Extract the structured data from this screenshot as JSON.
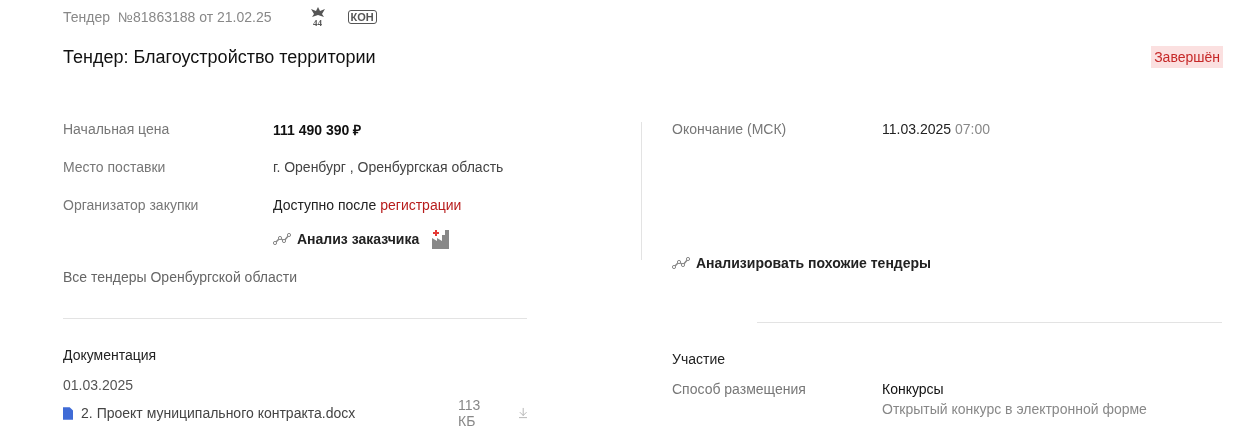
{
  "header": {
    "label": "Тендер",
    "number": "№81863188 от 21.02.25",
    "law_badge": "44",
    "type_badge": "КОН"
  },
  "title": "Тендер: Благоустройство территории",
  "status": "Завершён",
  "left_fields": [
    {
      "label": "Начальная цена",
      "value": "111 490 390 ₽",
      "kind": "price"
    },
    {
      "label": "Место поставки",
      "value": "г. Оренбург , Оренбургская область",
      "kind": "text"
    },
    {
      "label": "Организатор закупки",
      "value": "Доступно после",
      "link": "регистрации",
      "kind": "locked"
    }
  ],
  "customer_analysis": "Анализ заказчика",
  "region_link": "Все тендеры Оренбургской области",
  "right_fields": [
    {
      "label": "Окончание (МСК)",
      "value": "11.03.2025",
      "time": "07:00"
    }
  ],
  "similar_link": "Анализировать похожие тендеры",
  "documentation": {
    "title": "Документация",
    "date": "01.03.2025",
    "files": [
      {
        "name": "2. Проект муниципального контракта.docx",
        "size": "113 КБ"
      }
    ]
  },
  "participation": {
    "title": "Участие",
    "label": "Способ размещения",
    "value": "Конкурсы",
    "detail": "Открытый конкурс в электронной форме"
  }
}
